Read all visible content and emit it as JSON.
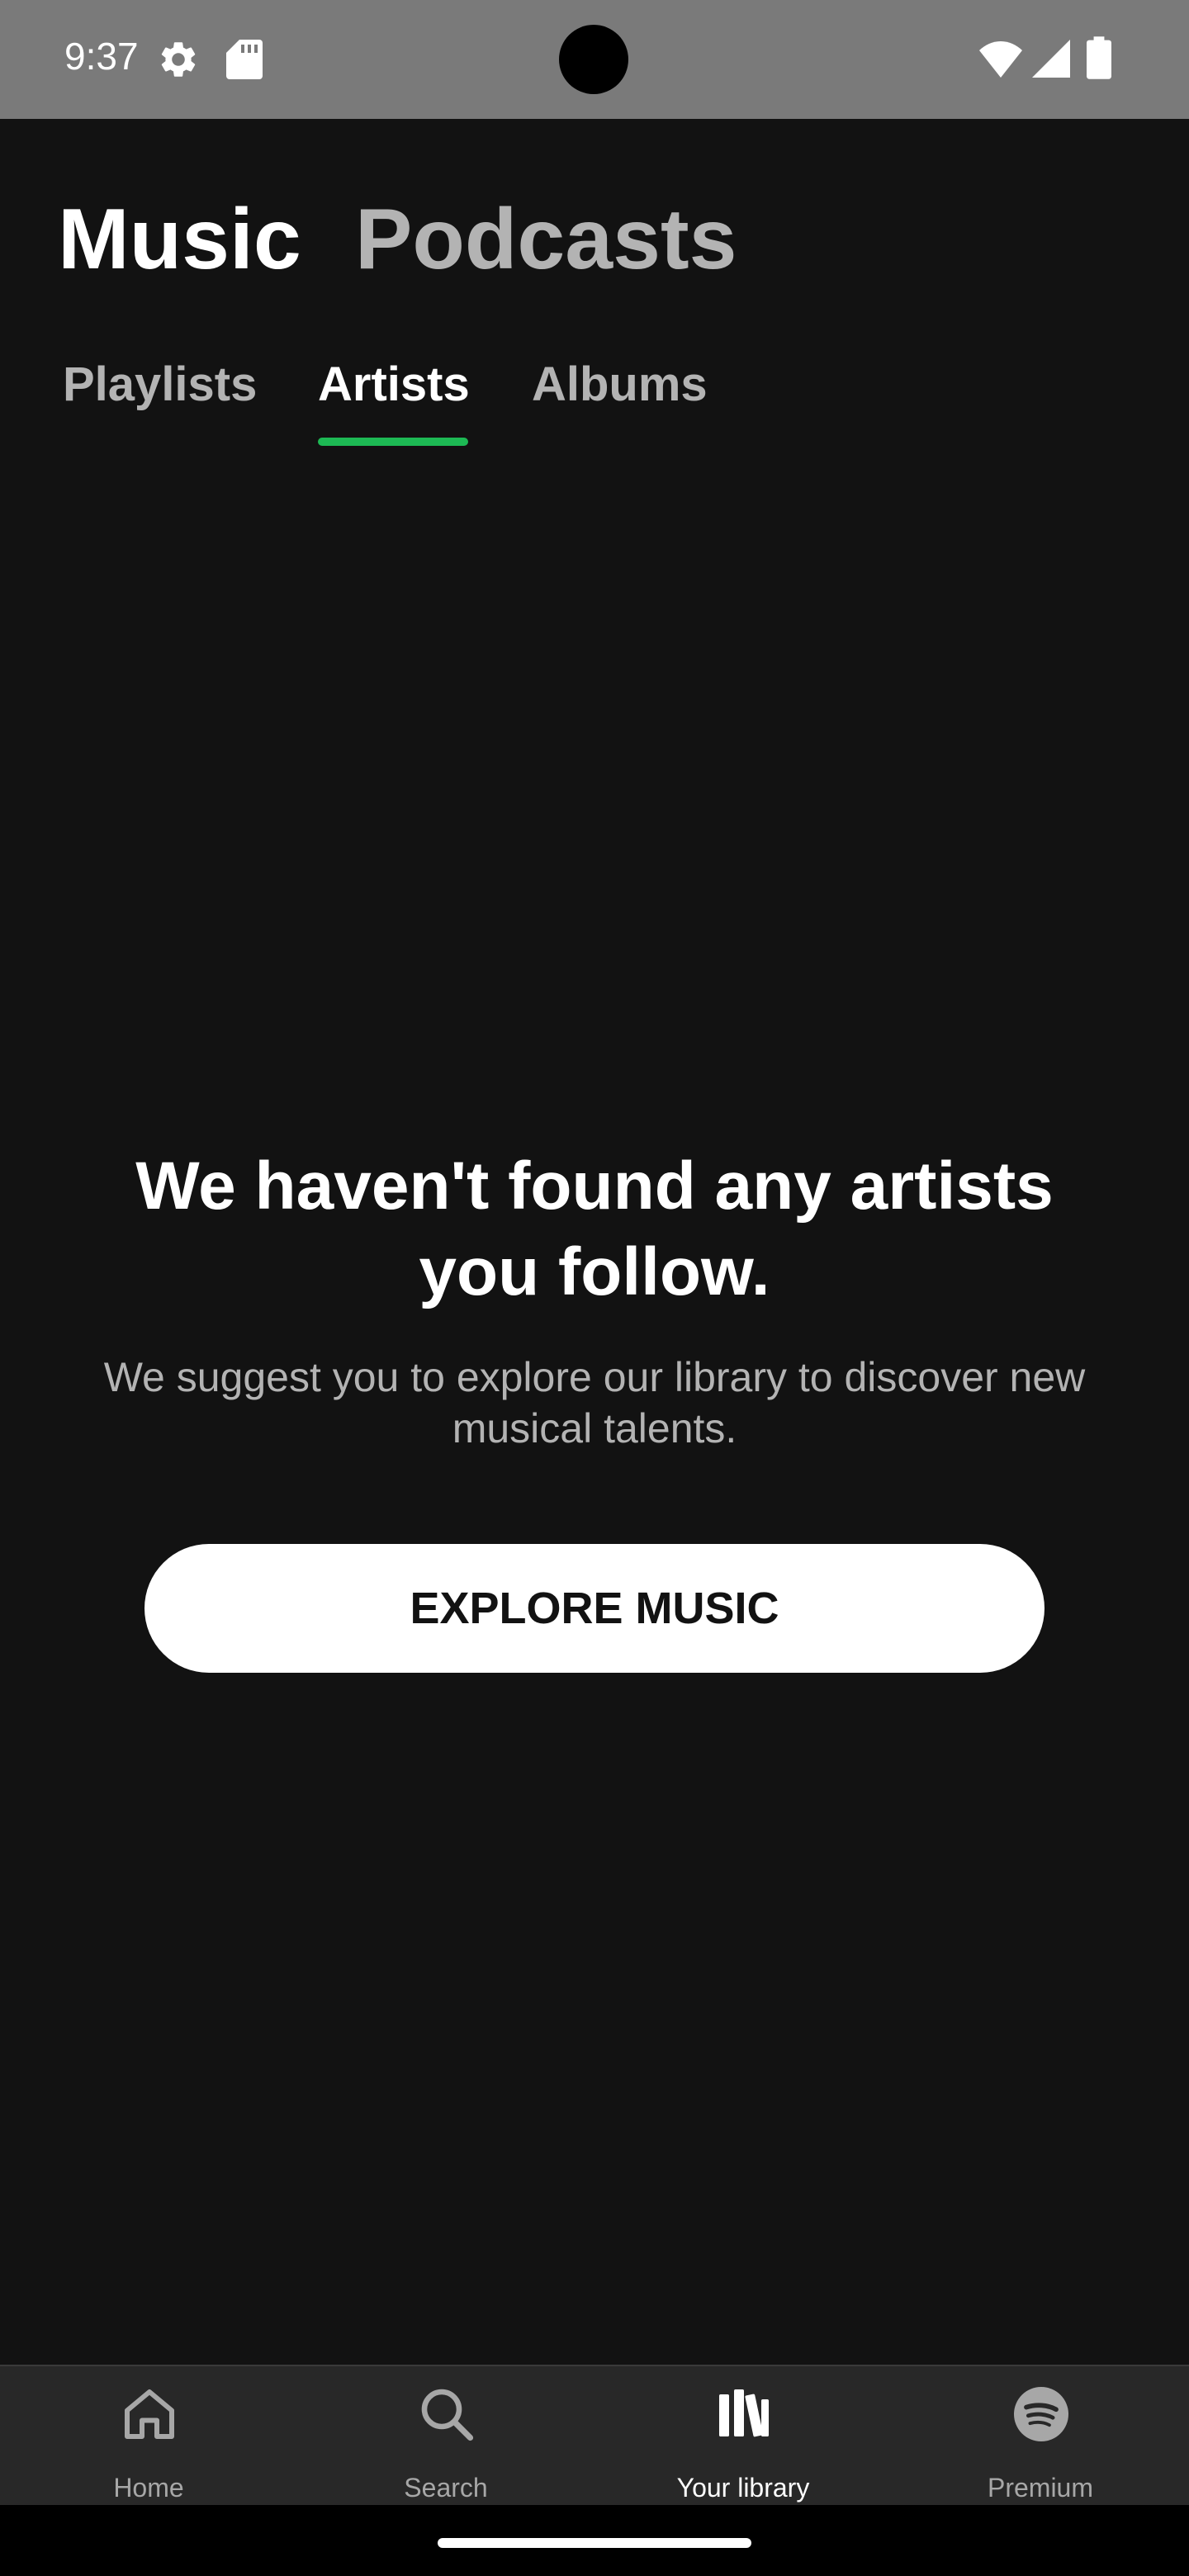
{
  "status_bar": {
    "time": "9:37",
    "icons": [
      "gear-icon",
      "sd-card-icon",
      "wifi-icon",
      "signal-icon",
      "battery-icon"
    ]
  },
  "top_tabs": [
    {
      "label": "Music",
      "active": true
    },
    {
      "label": "Podcasts",
      "active": false
    }
  ],
  "sub_tabs": [
    {
      "label": "Playlists",
      "active": false
    },
    {
      "label": "Artists",
      "active": true
    },
    {
      "label": "Albums",
      "active": false
    }
  ],
  "empty_state": {
    "heading": "We haven't found any artists you follow.",
    "subtext": "We suggest you to explore our library to discover new musical talents.",
    "button_label": "EXPLORE MUSIC"
  },
  "bottom_nav": [
    {
      "label": "Home",
      "icon": "home-icon",
      "active": false
    },
    {
      "label": "Search",
      "icon": "search-icon",
      "active": false
    },
    {
      "label": "Your library",
      "icon": "library-icon",
      "active": true
    },
    {
      "label": "Premium",
      "icon": "spotify-icon",
      "active": false
    }
  ],
  "colors": {
    "background": "#121212",
    "status_bar": "#7a7a7a",
    "accent": "#1db954",
    "inactive_tab": "#b3b3b3",
    "nav_background": "#282828",
    "nav_inactive": "#a7a7a7"
  }
}
